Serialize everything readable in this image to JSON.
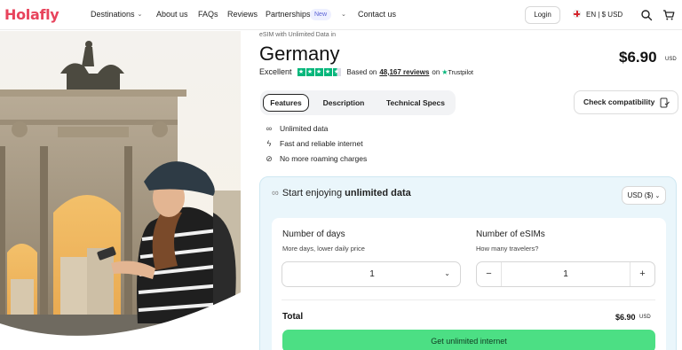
{
  "brand": {
    "logo_text": "Holafly",
    "accent": "#e8435c"
  },
  "nav": {
    "destinations": "Destinations",
    "about": "About us",
    "faqs": "FAQs",
    "reviews": "Reviews",
    "partnerships": "Partnerships",
    "new_badge": "New",
    "contact": "Contact us",
    "login": "Login",
    "language": "EN | $ USD",
    "icons": [
      "chevron-down-icon",
      "flag-icon",
      "search-icon",
      "cart-icon"
    ]
  },
  "product": {
    "eyebrow": "eSIM with Unlimited Data in",
    "title": "Germany",
    "price": "$6.90",
    "price_currency": "USD",
    "rating_label": "Excellent",
    "based_on": "Based on",
    "reviews_count": "48,167 reviews",
    "on": "on",
    "trustpilot": "Trustpilot",
    "stars": 4.5
  },
  "tabs": [
    {
      "label": "Features",
      "active": true
    },
    {
      "label": "Description",
      "active": false
    },
    {
      "label": "Technical Specs",
      "active": false
    }
  ],
  "check_compatibility": "Check compatibility",
  "features": [
    {
      "icon": "infinity-icon",
      "text": "Unlimited data"
    },
    {
      "icon": "lightning-icon",
      "text": "Fast and reliable internet"
    },
    {
      "icon": "no-roaming-icon",
      "text": "No more roaming charges"
    }
  ],
  "purchase": {
    "title_prefix": "Start enjoying",
    "title_bold": "unlimited data",
    "currency_select": "USD ($)",
    "days_label": "Number of days",
    "days_sub": "More days, lower daily price",
    "days_value": "1",
    "esims_label": "Number of eSIMs",
    "esims_sub": "How many travelers?",
    "esims_value": "1",
    "minus": "−",
    "plus": "+",
    "total_label": "Total",
    "total_value": "$6.90",
    "total_currency": "USD",
    "cta": "Get unlimited internet",
    "cta_color": "#4cdf84"
  }
}
